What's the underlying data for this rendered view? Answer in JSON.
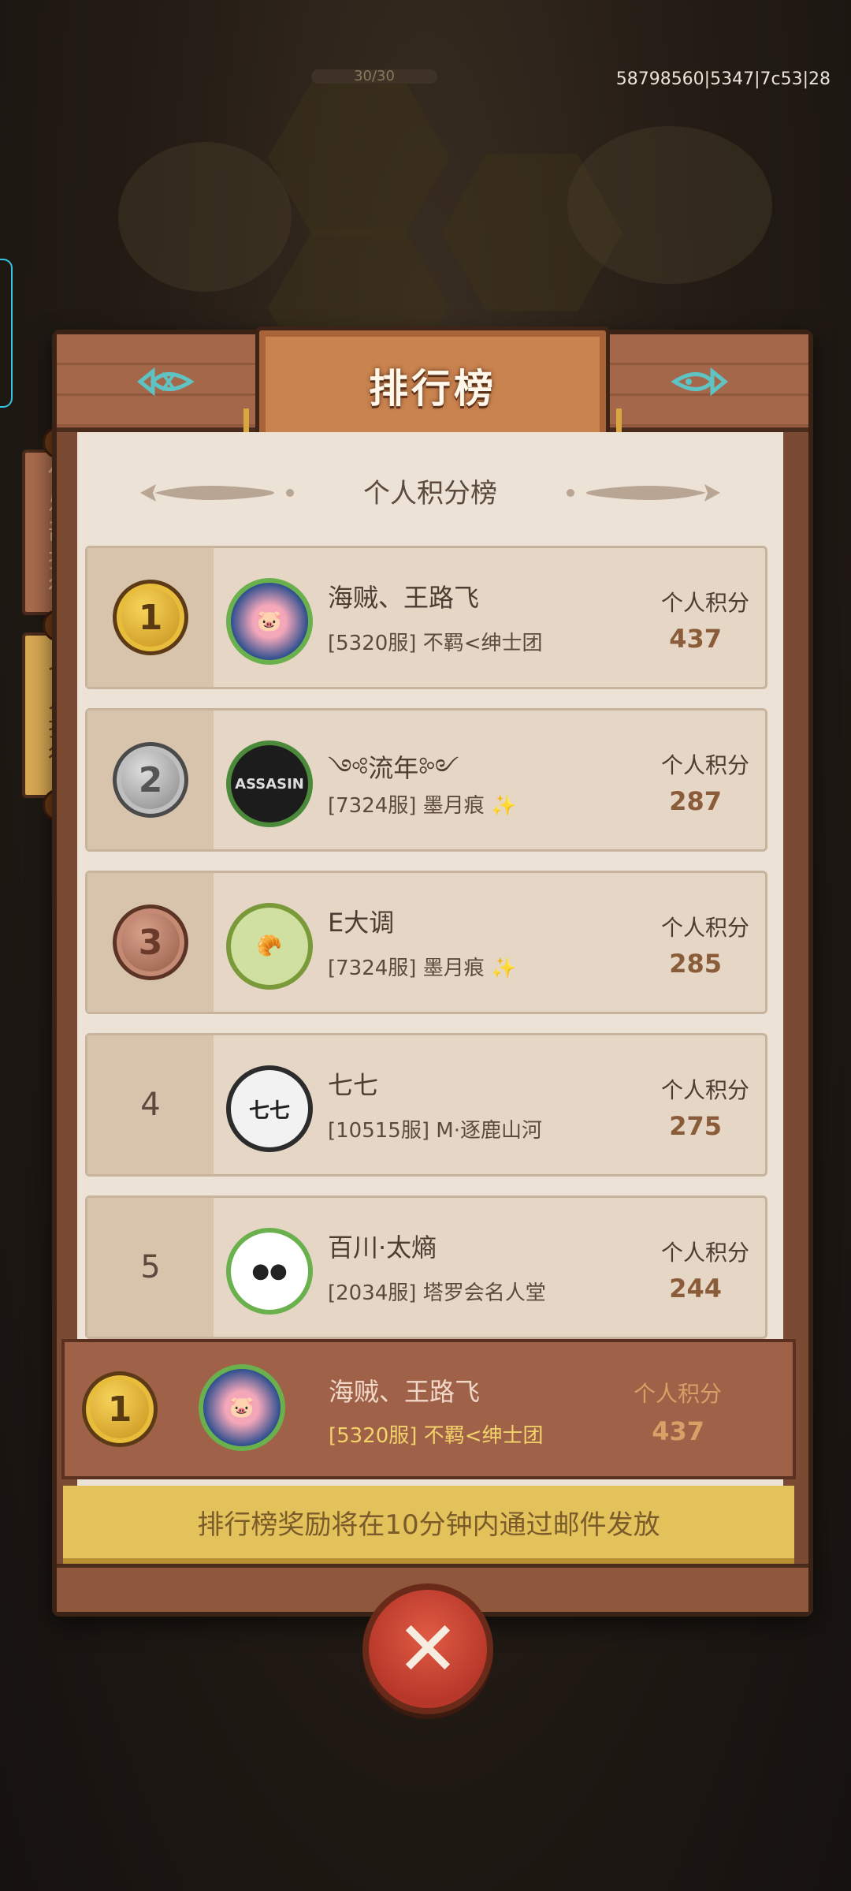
{
  "background": {
    "top_label": "30/30",
    "debug_id": "58798560|5347|7c53|28"
  },
  "panel": {
    "title": "排行榜",
    "subtitle": "个人积分榜",
    "notice": "排行榜奖励将在10分钟内通过邮件发放"
  },
  "tabs": {
    "club": "俱乐部排行",
    "personal": "个人排行"
  },
  "score_label": "个人积分",
  "rows": [
    {
      "rank": "1",
      "medal": "gold",
      "name": "海贼、王路飞",
      "guild": "[5320服] 不羁<绅士团",
      "score": "437",
      "avatar": "pirate-pig-avatar"
    },
    {
      "rank": "2",
      "medal": "silver",
      "name": "༺流年༻",
      "guild": "[7324服]  墨月痕 ✨",
      "score": "287",
      "avatar": "assassin-avatar"
    },
    {
      "rank": "3",
      "medal": "bronze",
      "name": "E大调",
      "guild": "[7324服]  墨月痕 ✨",
      "score": "285",
      "avatar": "bread-avatar"
    },
    {
      "rank": "4",
      "medal": "",
      "name": "七七",
      "guild": "[10515服] M·逐鹿山河",
      "score": "275",
      "avatar": "qiqi-avatar"
    },
    {
      "rank": "5",
      "medal": "",
      "name": "百川·太熵",
      "guild": "[2034服] 塔罗会名人堂",
      "score": "244",
      "avatar": "meme-avatar"
    }
  ],
  "my_rank": {
    "rank": "1",
    "name": "海贼、王路飞",
    "guild": "[5320服] 不羁<绅士团",
    "score": "437",
    "score_label": "个人积分"
  },
  "avatar_text": {
    "assassin": "ASSASIN",
    "qiqi": "七七"
  }
}
